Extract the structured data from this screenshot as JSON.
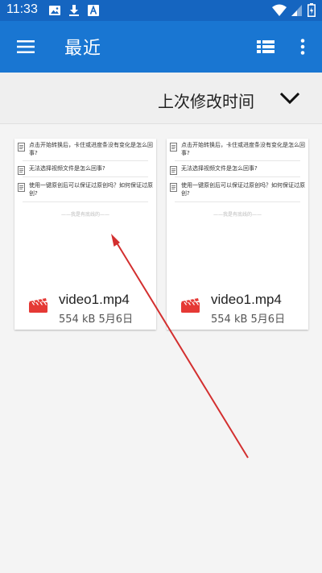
{
  "status_bar": {
    "time": "11:33",
    "left_icons": [
      "image-icon",
      "download-icon",
      "a-box-icon"
    ],
    "right_icons": [
      "wifi-icon",
      "signal-icon",
      "battery-icon"
    ]
  },
  "app_bar": {
    "title": "最近",
    "bg_color": "#1976d2"
  },
  "sort": {
    "label": "上次修改时间"
  },
  "files": [
    {
      "name": "video1.mp4",
      "meta": "554 kB 5月6日",
      "thumb_items": [
        "点击开始转换后，卡住或进度条没有变化是怎么回事?",
        "无法选择视频文件是怎么回事?",
        "使用一键原创后可以保证过原创吗？如何保证过原创?"
      ],
      "thumb_end": "——我是有底线的——"
    },
    {
      "name": "video1.mp4",
      "meta": "554 kB 5月6日",
      "thumb_items": [
        "点击开始转换后，卡住或进度条没有变化是怎么回事?",
        "无法选择视频文件是怎么回事?",
        "使用一键原创后可以保证过原创吗？如何保证过原创?"
      ],
      "thumb_end": "——我是有底线的——"
    }
  ],
  "colors": {
    "status_bar": "#1565c0",
    "video_icon": "#e53935",
    "arrow": "#d32f2f"
  }
}
